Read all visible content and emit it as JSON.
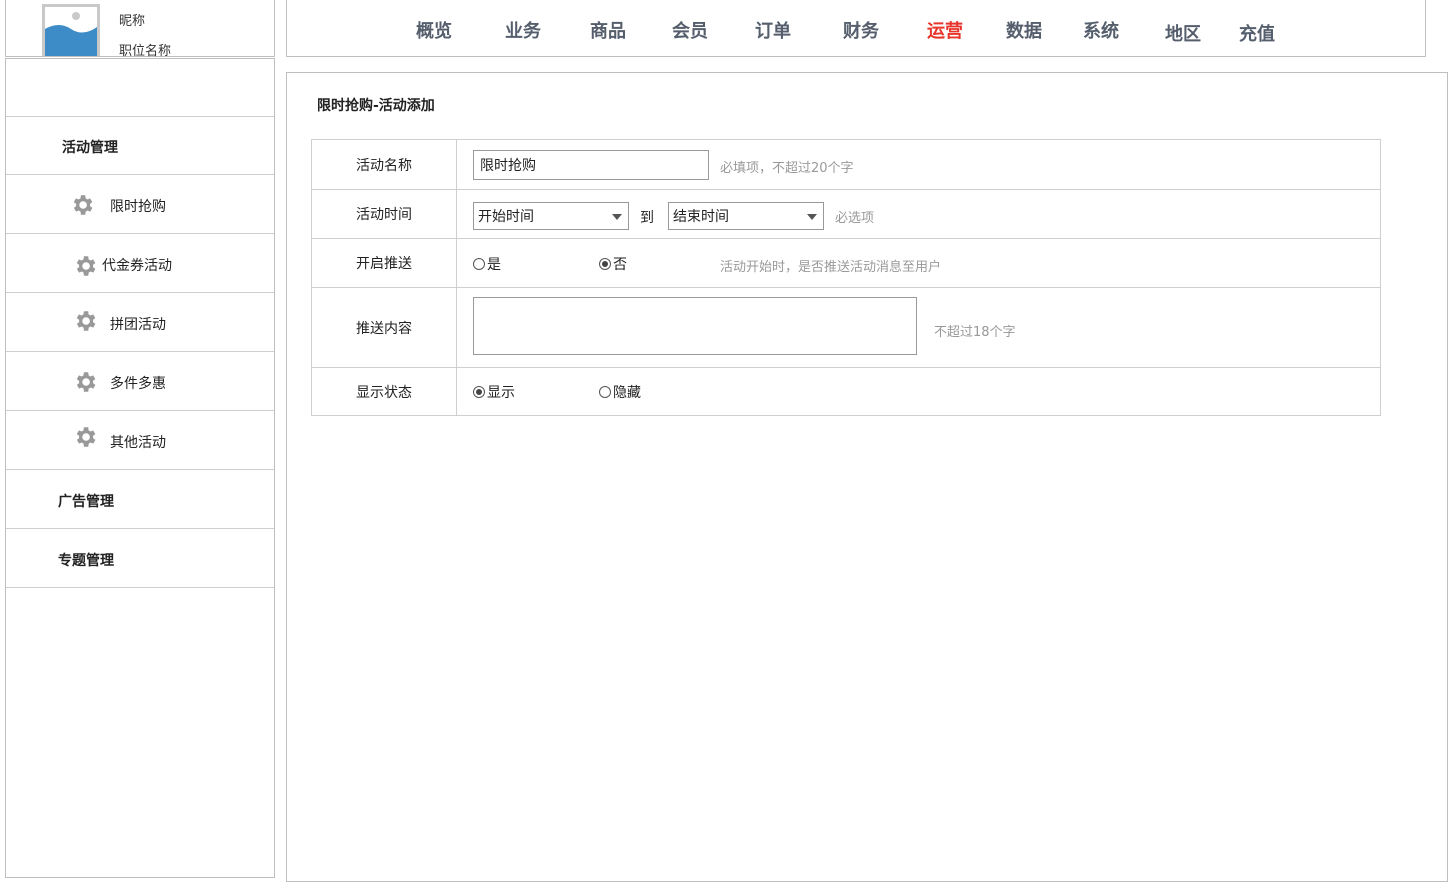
{
  "profile": {
    "nickname": "昵称",
    "position": "职位名称"
  },
  "topnav": {
    "items": [
      "概览",
      "业务",
      "商品",
      "会员",
      "订单",
      "财务",
      "运营",
      "数据",
      "系统",
      "地区",
      "充值"
    ],
    "active": "运营",
    "active_color": "#e8352b"
  },
  "sidebar": {
    "groups": [
      {
        "label": "活动管理",
        "items": [
          "限时抢购",
          "代金券活动",
          "拼团活动",
          "多件多惠",
          "其他活动"
        ]
      },
      {
        "label": "广告管理"
      },
      {
        "label": "专题管理"
      }
    ],
    "icon": "gear-icon"
  },
  "form": {
    "title": "限时抢购-活动添加",
    "name": {
      "label": "活动名称",
      "value": "限时抢购",
      "hint": "必填项，不超过20个字"
    },
    "time": {
      "label": "活动时间",
      "start": "开始时间",
      "to": "到",
      "end": "结束时间",
      "hint": "必选项"
    },
    "push": {
      "label": "开启推送",
      "yes": "是",
      "no": "否",
      "selected": "否",
      "hint": "活动开始时，是否推送活动消息至用户"
    },
    "content": {
      "label": "推送内容",
      "value": "",
      "hint": "不超过18个字"
    },
    "display": {
      "label": "显示状态",
      "show": "显示",
      "hide": "隐藏",
      "selected": "显示"
    }
  }
}
